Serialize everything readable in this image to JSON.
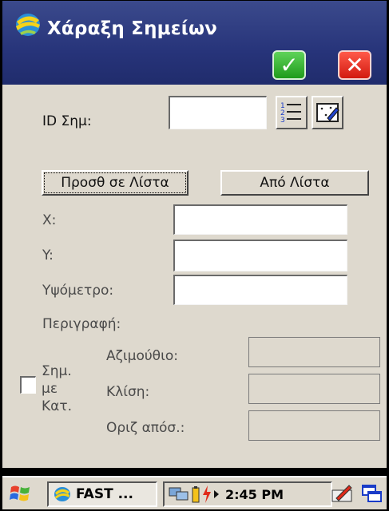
{
  "window": {
    "title": "Χάραξη Σημείων",
    "ok_label": "✓",
    "cancel_label": "✕"
  },
  "form": {
    "point_id_label": "ID Σημ:",
    "point_id_value": "",
    "add_to_list_label": "Προσθ σε Λίστα",
    "from_list_label": "Από Λίστα",
    "x_label": "X:",
    "x_value": "",
    "y_label": "Y:",
    "y_value": "",
    "elevation_label": "Υψόμετρο:",
    "elevation_value": "",
    "description_label": "Περιγραφή:",
    "with_direction_label_1": "Σημ.",
    "with_direction_label_2": "με",
    "with_direction_label_3": "Κατ.",
    "with_direction_checked": false,
    "azimuth_label": "Αζιμούθιο:",
    "slope_label": "Κλίση:",
    "horiz_dist_label": "Οριζ απόσ.:"
  },
  "taskbar": {
    "task_label": "FAST ...",
    "time": "2:45 PM"
  },
  "colors": {
    "titlebar": "#27347a",
    "client_bg": "#ded9ce",
    "ok_green": "#1f9b1b",
    "cancel_red": "#d21a10"
  }
}
